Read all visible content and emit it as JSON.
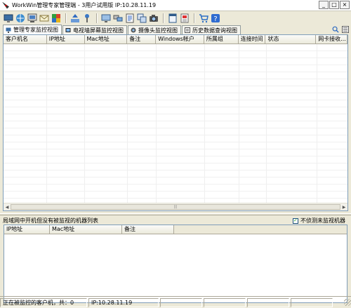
{
  "window": {
    "title": "WorkWin管理专家管理端 - 3用户试用版 IP:10.28.11.19",
    "controls": {
      "minimize": "_",
      "maximize": "□",
      "close": "×"
    }
  },
  "toolbar": {
    "groups": [
      [
        "computer-icon",
        "network-icon",
        "monitor-icon",
        "envelope-icon",
        "puzzle-icon"
      ],
      [
        "upload-icon",
        "pin-icon"
      ],
      [
        "screen-icon",
        "remote-icon",
        "document-icon",
        "copy-icon",
        "camera-icon"
      ],
      [
        "window-icon",
        "stop-icon"
      ],
      [
        "cart-icon",
        "help-icon"
      ]
    ]
  },
  "tabs": [
    {
      "label": "管理专家监控视图",
      "active": true,
      "icon": "monitor-tab-icon"
    },
    {
      "label": "电视墙屏幕监控视图",
      "active": false,
      "icon": "tv-wall-icon"
    },
    {
      "label": "摄像头监控视图",
      "active": false,
      "icon": "webcam-icon"
    },
    {
      "label": "历史数据查询视图",
      "active": false,
      "icon": "history-icon"
    }
  ],
  "main_table": {
    "columns": [
      "客户机名",
      "IP地址",
      "Mac地址",
      "备注",
      "Windows帐户",
      "所属组",
      "连接时间",
      "状态",
      "网卡接收..."
    ],
    "rows": []
  },
  "lower_panel": {
    "title": "局域网中开机但没有被监视的机器列表",
    "checkbox_label": "不侦测未监视机器",
    "checkbox_checked": true,
    "columns": [
      "IP地址",
      "Mac地址",
      "备注"
    ],
    "rows": []
  },
  "status": {
    "left": "正在被监控的客户机，共：0",
    "ip": "IP:10.28.11.19"
  },
  "colors": {
    "chrome": "#ece9d8",
    "border": "#7f9db9",
    "grid_bg": "#ffffff"
  }
}
